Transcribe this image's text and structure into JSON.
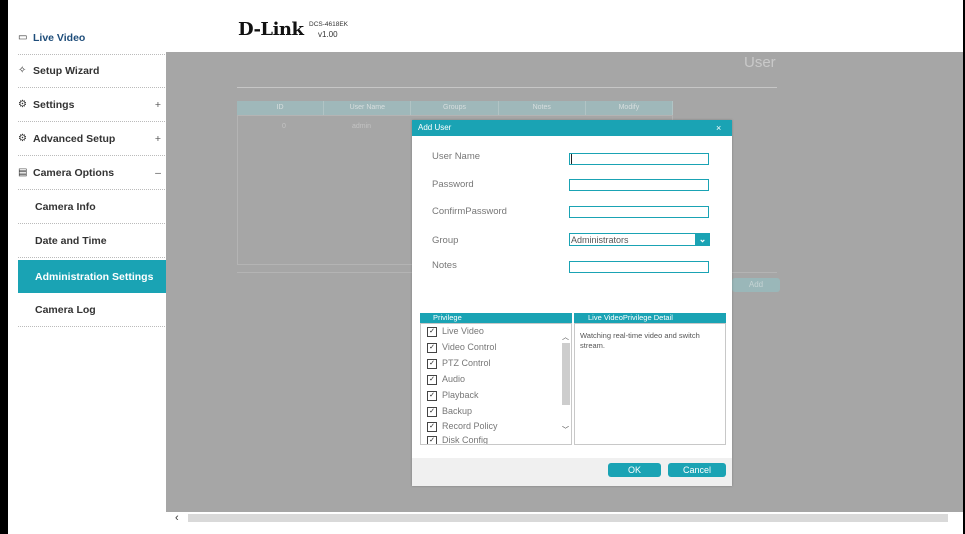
{
  "brand": {
    "logo": "D-Link",
    "model": "DCS-4618EK",
    "version": "v1.00"
  },
  "sidebar": {
    "items": [
      {
        "label": "Live Video",
        "icon": "video-icon"
      },
      {
        "label": "Setup Wizard",
        "icon": "wand-icon"
      },
      {
        "label": "Settings",
        "icon": "gear-icon",
        "toggle": "+"
      },
      {
        "label": "Advanced Setup",
        "icon": "gears-icon",
        "toggle": "+"
      },
      {
        "label": "Camera Options",
        "icon": "clipboard-icon",
        "toggle": "–"
      },
      {
        "label": "Camera Info"
      },
      {
        "label": "Date and Time"
      },
      {
        "label": "Administration Settings",
        "active": true
      },
      {
        "label": "Camera Log"
      }
    ]
  },
  "page": {
    "title": "User",
    "table": {
      "columns": [
        "ID",
        "User Name",
        "Groups",
        "Notes",
        "Modify"
      ],
      "rows": [
        {
          "id": "0",
          "user": "admin"
        }
      ]
    },
    "add_label": "Add"
  },
  "modal": {
    "title": "Add User",
    "close": "×",
    "fields": {
      "user_name": {
        "label": "User Name",
        "value": ""
      },
      "password": {
        "label": "Password",
        "value": ""
      },
      "confirm_password": {
        "label": "ConfirmPassword",
        "value": ""
      },
      "group": {
        "label": "Group",
        "value": "Administrators"
      },
      "notes": {
        "label": "Notes",
        "value": ""
      }
    },
    "privilege": {
      "header": "Privilege",
      "items": [
        "Live Video",
        "Video Control",
        "PTZ Control",
        "Audio",
        "Playback",
        "Backup",
        "Record Policy",
        "Disk Config"
      ],
      "checked": [
        true,
        true,
        true,
        true,
        true,
        true,
        true,
        true
      ]
    },
    "detail": {
      "header": "Live VideoPrivilege Detail",
      "text": "Watching real-time video and switch stream."
    },
    "ok": "OK",
    "cancel": "Cancel"
  },
  "colors": {
    "accent": "#1aa3b4",
    "overlay": "#a6a6a6",
    "active_sidebar": "#1aa3b4"
  }
}
